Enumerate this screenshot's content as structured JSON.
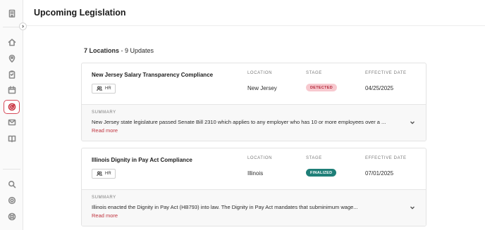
{
  "header": {
    "title": "Upcoming Legislation"
  },
  "summary": {
    "locations": "7 Locations",
    "separator": " - ",
    "updates": "9 Updates"
  },
  "columns": {
    "location": "LOCATION",
    "stage": "STAGE",
    "effective_date": "EFFECTIVE DATE",
    "summary": "SUMMARY"
  },
  "sidebar": {
    "icons": [
      "building-icon",
      "home-icon",
      "location-pin-icon",
      "clipboard-icon",
      "calendar-icon",
      "radar-icon",
      "mail-icon",
      "book-icon",
      "search-icon",
      "settings-icon",
      "help-icon"
    ],
    "active": "radar-icon",
    "active_color": "#d64a5a"
  },
  "cards": [
    {
      "title": "New Jersey Salary Transparency Compliance",
      "department": "HR",
      "location": "New Jersey",
      "stage": "DETECTED",
      "stage_color": "#f7c9cf",
      "effective_date": "04/25/2025",
      "summary": "New Jersey state legislature passed Senate Bill 2310 which applies to any employer who has 10 or more employees over a ...",
      "read_more": "Read more"
    },
    {
      "title": "Illinois Dignity in Pay Act Compliance",
      "department": "HR",
      "location": "Illinois",
      "stage": "FINALIZED",
      "stage_color": "#1f7f78",
      "effective_date": "07/01/2025",
      "summary": "Illinois enacted the Dignity in Pay Act (HB793) into law. The Dignity in Pay Act mandates that subminimum wage...",
      "read_more": "Read more"
    }
  ]
}
